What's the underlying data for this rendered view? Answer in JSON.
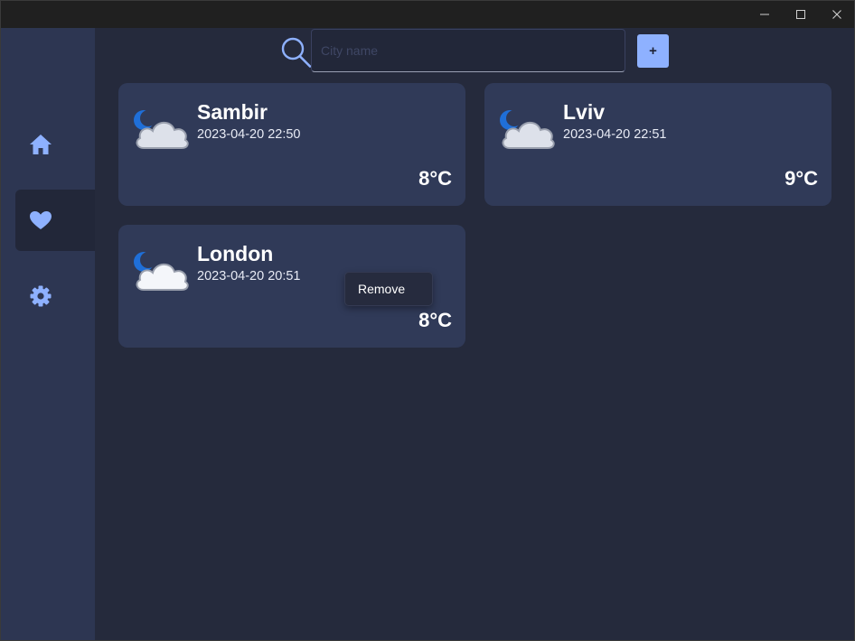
{
  "window": {
    "controls": {
      "minimize_icon": "minimize-icon",
      "maximize_icon": "maximize-icon",
      "close_icon": "close-icon"
    }
  },
  "sidebar": {
    "items": [
      {
        "icon": "home-icon",
        "active": false
      },
      {
        "icon": "heart-icon",
        "active": true
      },
      {
        "icon": "gear-icon",
        "active": false
      }
    ]
  },
  "search": {
    "placeholder": "City name",
    "value": "",
    "add_label": "+"
  },
  "cities": [
    {
      "name": "Sambir",
      "time": "2023-04-20 22:50",
      "temp": "8°C",
      "icon": "moon-cloud-icon"
    },
    {
      "name": "Lviv",
      "time": "2023-04-20 22:51",
      "temp": "9°C",
      "icon": "moon-cloud-icon"
    },
    {
      "name": "London",
      "time": "2023-04-20 20:51",
      "temp": "8°C",
      "icon": "moon-cloud-icon"
    }
  ],
  "context_menu": {
    "items": [
      "Remove"
    ]
  },
  "colors": {
    "background": "#252a3c",
    "sidebar": "#2d3652",
    "card": "#303a58",
    "accent": "#8eb1ff",
    "moon": "#1f6fd8"
  }
}
